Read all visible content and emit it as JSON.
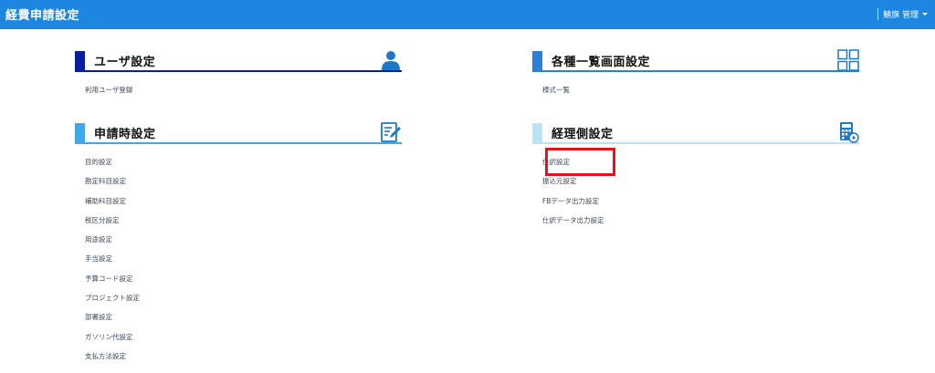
{
  "header": {
    "app_title": "経費申請設定",
    "user_menu_label": "鯖旗 管理"
  },
  "sections": [
    {
      "title": "ユーザ設定",
      "icon": "user-icon",
      "accent": "#0a1fa0",
      "items": [
        "利用ユーザ登録"
      ]
    },
    {
      "title": "各種一覧画面設定",
      "icon": "grid-icon",
      "accent": "#2a7fd6",
      "items": [
        "様式一覧"
      ]
    },
    {
      "title": "申請時設定",
      "icon": "edit-document-icon",
      "accent": "#3ea9e8",
      "items": [
        "目的設定",
        "勘定科目設定",
        "補助科目設定",
        "税区分設定",
        "用途設定",
        "手当設定",
        "予算コード設定",
        "プロジェクト設定",
        "部署設定",
        "ガソリン代設定",
        "支払方法設定"
      ]
    },
    {
      "title": "経理側設定",
      "icon": "calculator-icon",
      "accent": "#b8e4f5",
      "items": [
        "仕訳設定",
        "振込元設定",
        "FBデータ出力設定",
        "仕訳データ出力設定"
      ]
    }
  ],
  "colors": {
    "topbar": "#1c86e0",
    "highlight": "#e8121c"
  }
}
